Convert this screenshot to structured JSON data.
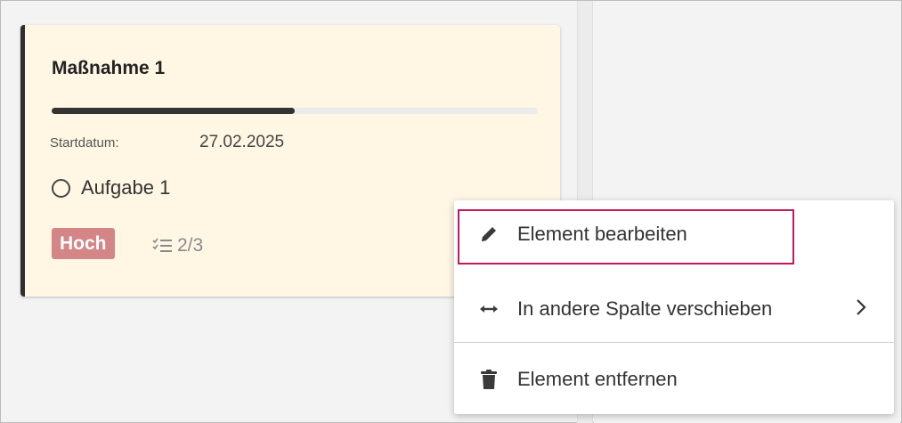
{
  "card": {
    "title": "Maßnahme 1",
    "progress": 0.5,
    "start_date_label": "Startdatum:",
    "start_date_value": "27.02.2025",
    "task_label": "Aufgabe 1",
    "priority_label": "Hoch",
    "priority_color": "#d48686",
    "subtask_count": "2/3",
    "subtask_icon": "checklist-icon",
    "accent_color": "#2f2f2f",
    "background_color": "#fff6e4"
  },
  "context_menu": {
    "items": [
      {
        "label": "Element bearbeiten",
        "icon": "pencil-icon"
      },
      {
        "label": "In andere Spalte verschieben",
        "icon": "arrows-horizontal-icon",
        "submenu": true
      },
      {
        "label": "Element entfernen",
        "icon": "trash-icon"
      }
    ],
    "highlight_color": "#c2185b"
  }
}
